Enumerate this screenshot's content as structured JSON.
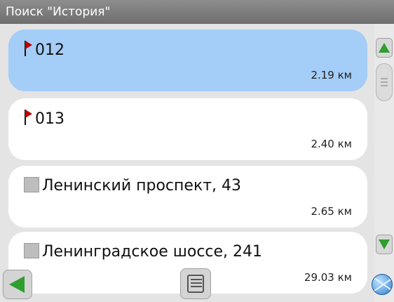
{
  "title": "Поиск \"История\"",
  "items": [
    {
      "name": "012",
      "distance": "2.19 км",
      "icon": "flag-icon",
      "selected": true
    },
    {
      "name": "013",
      "distance": "2.40 км",
      "icon": "flag-icon",
      "selected": false
    },
    {
      "name": "Ленинский проспект, 43",
      "distance": "2.65 км",
      "icon": "square-icon",
      "selected": false
    },
    {
      "name": "Ленинградское шоссе, 241",
      "distance": "29.03 км",
      "icon": "square-icon",
      "selected": false
    }
  ],
  "colors": {
    "selected": "#a4cdf7",
    "accent": "#2f9d2f",
    "flag": "#c00000"
  }
}
